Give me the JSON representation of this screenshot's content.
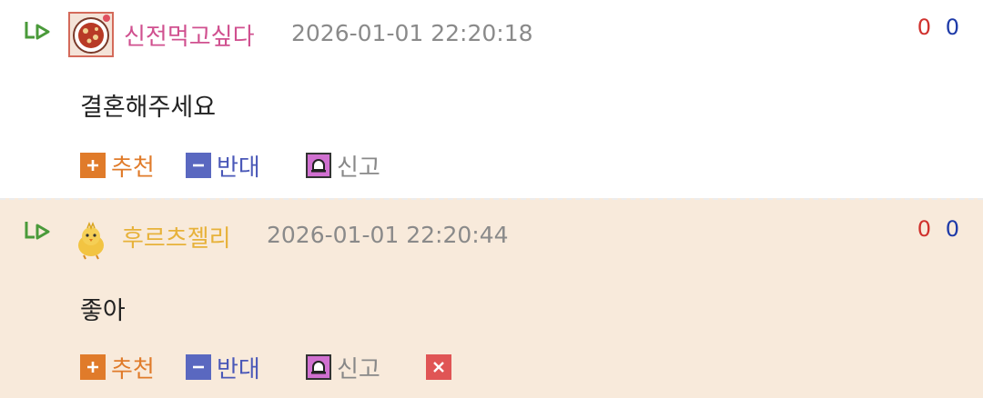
{
  "comments": [
    {
      "nickname": "신전먹고싶다",
      "timestamp": "2026-01-01 22:20:18",
      "text": "결혼해주세요",
      "upvotes": "0",
      "downvotes": "0",
      "actions": {
        "recommend": "추천",
        "oppose": "반대",
        "report": "신고"
      }
    },
    {
      "nickname": "후르츠젤리",
      "timestamp": "2026-01-01 22:20:44",
      "text": "좋아",
      "upvotes": "0",
      "downvotes": "0",
      "actions": {
        "recommend": "추천",
        "oppose": "반대",
        "report": "신고"
      }
    }
  ],
  "colors": {
    "nickname_1": "#d0508f",
    "nickname_2": "#e7b23a",
    "upvote": "#d0312d",
    "downvote": "#1e3aa8",
    "recommend": "#e07b2a",
    "oppose": "#4a58b8",
    "report": "#888888",
    "delete": "#e05555",
    "highlight_bg": "#f8eadb"
  },
  "icons": {
    "reply": "reply-arrow-icon",
    "avatar_1": "food-bowl-avatar-icon",
    "avatar_2": "yellow-chick-avatar-icon",
    "recommend": "plus-square-icon",
    "oppose": "minus-square-icon",
    "report": "siren-icon",
    "delete": "close-square-icon"
  }
}
